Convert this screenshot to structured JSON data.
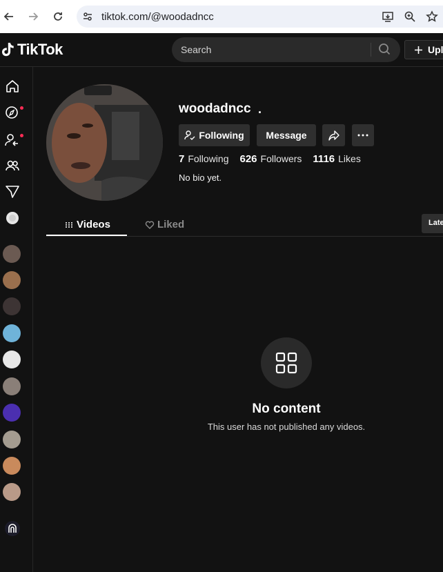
{
  "browser": {
    "url": "tiktok.com/@woodadncc"
  },
  "header": {
    "logo_text": "TikTok",
    "search_placeholder": "Search",
    "upload_label": "Upl"
  },
  "profile": {
    "username": "woodadncc",
    "username_suffix": ".",
    "following_button": "Following",
    "message_button": "Message",
    "following_count": "7",
    "following_label": "Following",
    "followers_count": "626",
    "followers_label": "Followers",
    "likes_count": "1116",
    "likes_label": "Likes",
    "bio": "No bio yet."
  },
  "tabs": {
    "videos": "Videos",
    "liked": "Liked",
    "sort": "Late"
  },
  "empty_state": {
    "title": "No content",
    "subtitle": "This user has not published any videos."
  },
  "sidebar": {
    "icons": [
      "home-icon",
      "explore-icon",
      "following-icon",
      "friends-icon",
      "messages-icon",
      "profile-icon"
    ],
    "avatar_colors": [
      "#6b5a52",
      "#9a6f4d",
      "#3d3434",
      "#6fb3d9",
      "#e8e8e8",
      "#8a7f78",
      "#4b2fb0",
      "#a49c90",
      "#c98a5c",
      "#b99a88"
    ]
  },
  "colors": {
    "accent": "#fe2c55",
    "background": "#121212"
  }
}
